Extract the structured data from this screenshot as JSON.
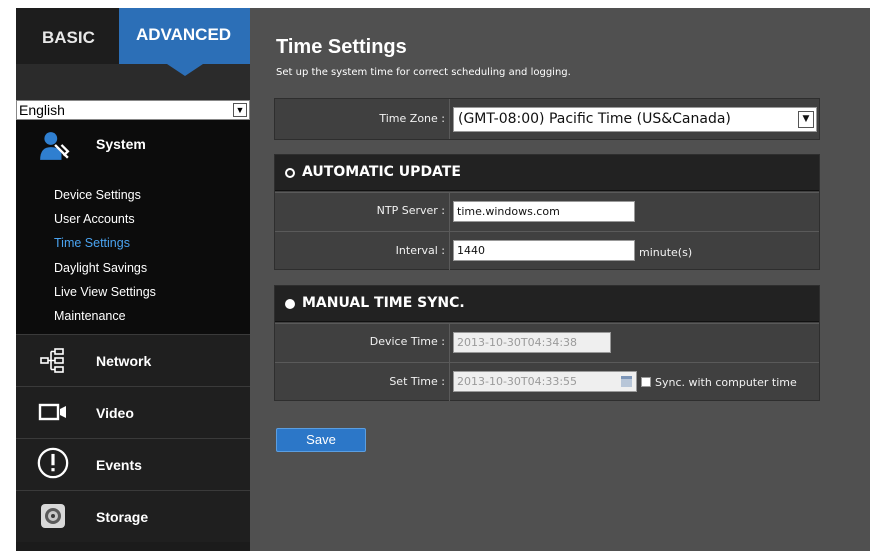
{
  "sidebar": {
    "tabs": {
      "basic": "BASIC",
      "advanced": "ADVANCED"
    },
    "language": "English",
    "system": {
      "label": "System",
      "items": [
        {
          "label": "Device Settings",
          "active": false
        },
        {
          "label": "User Accounts",
          "active": false
        },
        {
          "label": "Time Settings",
          "active": true
        },
        {
          "label": "Daylight Savings",
          "active": false
        },
        {
          "label": "Live View Settings",
          "active": false
        },
        {
          "label": "Maintenance",
          "active": false
        }
      ]
    },
    "sections": [
      {
        "label": "Network",
        "icon": "network-icon"
      },
      {
        "label": "Video",
        "icon": "camera-icon"
      },
      {
        "label": "Events",
        "icon": "alert-icon"
      },
      {
        "label": "Storage",
        "icon": "storage-icon"
      }
    ]
  },
  "main": {
    "title": "Time Settings",
    "subtitle": "Set up the system time for correct scheduling and logging.",
    "timezone": {
      "label": "Time Zone :",
      "value": "(GMT-08:00) Pacific Time (US&Canada)"
    },
    "automatic": {
      "heading": "AUTOMATIC UPDATE",
      "selected": false,
      "ntp_label": "NTP Server :",
      "ntp_value": "time.windows.com",
      "interval_label": "Interval :",
      "interval_value": "1440",
      "interval_unit": "minute(s)"
    },
    "manual": {
      "heading": "MANUAL TIME SYNC.",
      "selected": true,
      "device_time_label": "Device Time :",
      "device_time_value": "2013-10-30T04:34:38",
      "set_time_label": "Set Time :",
      "set_time_value": "2013-10-30T04:33:55",
      "sync_label": "Sync. with computer time"
    },
    "save_label": "Save"
  },
  "colors": {
    "accent": "#2c6fb7",
    "active_link": "#4aa3f0",
    "panel": "#505050"
  }
}
